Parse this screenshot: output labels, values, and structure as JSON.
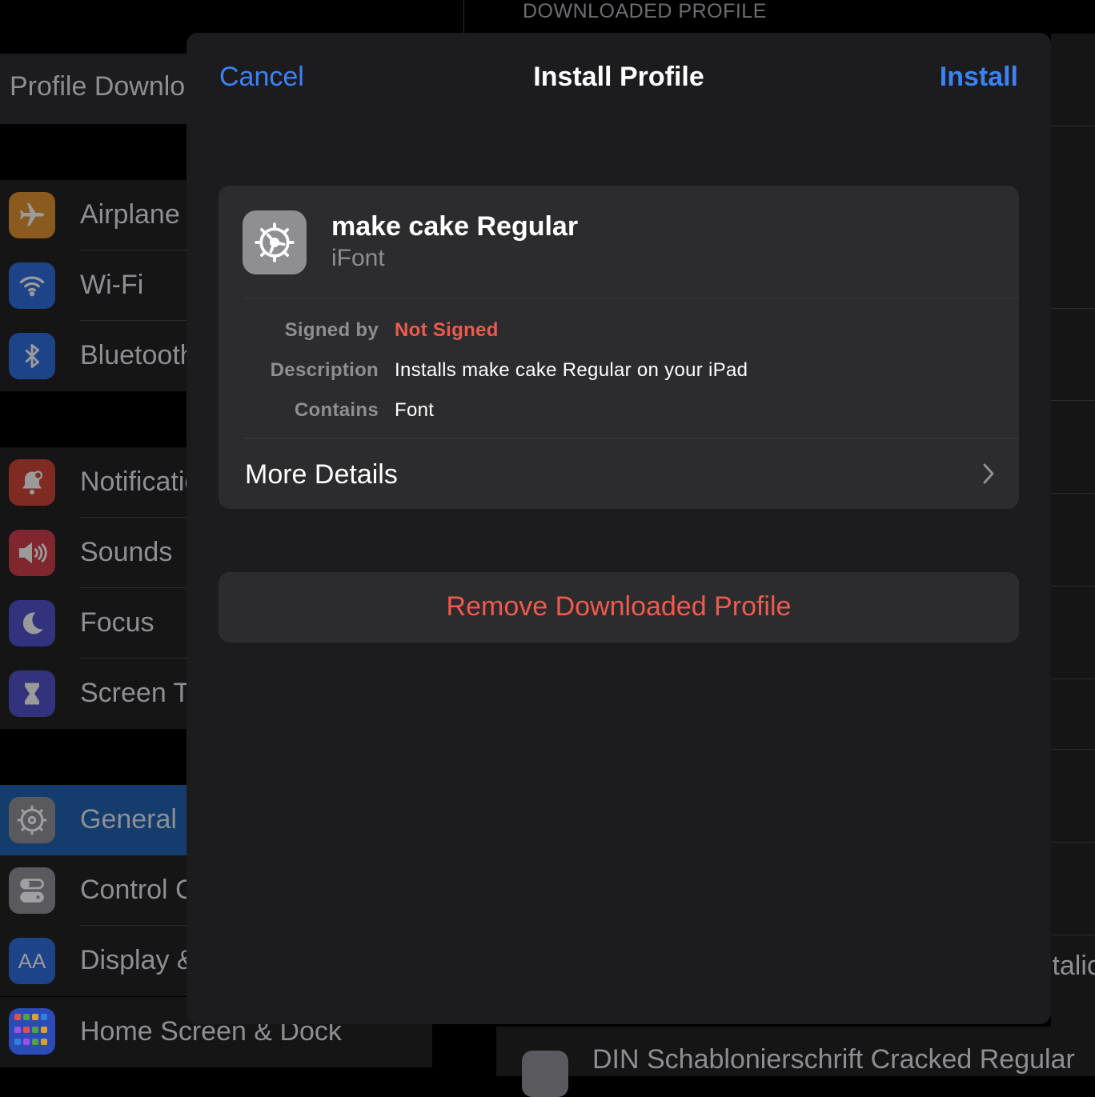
{
  "background": {
    "right_header": "DOWNLOADED PROFILE",
    "sidebar_top_label": "Profile Downlo",
    "sidebar_groups": [
      [
        {
          "label": "Airplane",
          "icon": "airplane-icon",
          "color": "#f09a37"
        },
        {
          "label": "Wi-Fi",
          "icon": "wifi-icon",
          "color": "#3478f6"
        },
        {
          "label": "Bluetooth",
          "icon": "bluetooth-icon",
          "color": "#3478f6"
        }
      ],
      [
        {
          "label": "Notifications",
          "icon": "bell-icon",
          "color": "#eb4d3d"
        },
        {
          "label": "Sounds",
          "icon": "speaker-icon",
          "color": "#eb445a"
        },
        {
          "label": "Focus",
          "icon": "moon-icon",
          "color": "#5e5ce6"
        },
        {
          "label": "Screen Time",
          "icon": "hourglass-icon",
          "color": "#5e5ce6"
        }
      ],
      [
        {
          "label": "General",
          "icon": "gear-icon",
          "color": "#8e8e93"
        },
        {
          "label": "Control Centre",
          "icon": "toggles-icon",
          "color": "#8e8e93"
        },
        {
          "label": "Display & Brightness",
          "icon": "text-size-icon",
          "color": "#3478f6"
        }
      ]
    ],
    "home_row_label": "Home Screen & Dock",
    "right_partial_label": "Italic",
    "bottom_row_label": "DIN Schablonierschrift Cracked Regular"
  },
  "modal": {
    "cancel_label": "Cancel",
    "title": "Install Profile",
    "install_label": "Install",
    "profile": {
      "name": "make cake Regular",
      "organization": "iFont",
      "icon": "gear-icon"
    },
    "fields": [
      {
        "label": "Signed by",
        "value": "Not Signed",
        "warning": true
      },
      {
        "label": "Description",
        "value": "Installs make cake Regular on your iPad",
        "warning": false
      },
      {
        "label": "Contains",
        "value": "Font",
        "warning": false
      }
    ],
    "more_details_label": "More Details",
    "remove_label": "Remove Downloaded Profile"
  },
  "colors": {
    "accent": "#3b82f6",
    "destructive": "#ef5a4d",
    "modal_bg": "#1c1c1e",
    "card_bg": "#2c2c2e"
  }
}
